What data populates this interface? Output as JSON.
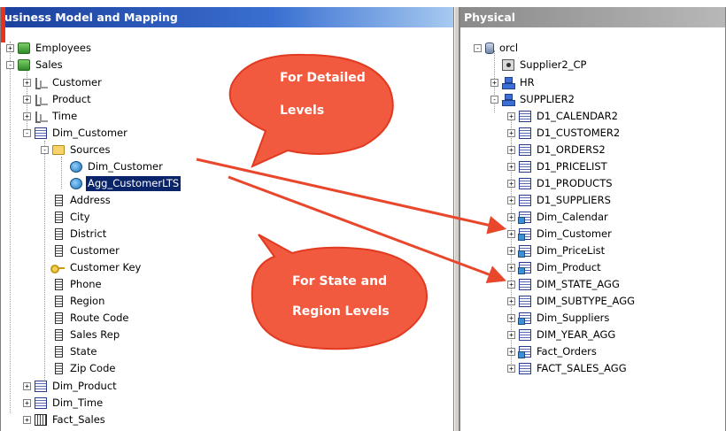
{
  "left_panel": {
    "title": "usiness Model and Mapping",
    "tree": [
      {
        "label": "Employees",
        "icon": "db-icon",
        "expander": "+"
      },
      {
        "label": "Sales",
        "icon": "db-icon",
        "expander": "-"
      },
      {
        "label": "Customer",
        "icon": "hierarchy-icon",
        "expander": "+"
      },
      {
        "label": "Product",
        "icon": "hierarchy-icon",
        "expander": "+"
      },
      {
        "label": "Time",
        "icon": "hierarchy-icon",
        "expander": "+"
      },
      {
        "label": "Dim_Customer",
        "icon": "table-icon",
        "expander": "-"
      },
      {
        "label": "Sources",
        "icon": "folder-icon",
        "expander": "-"
      },
      {
        "label": "Dim_Customer",
        "icon": "logical-table-source-icon"
      },
      {
        "label": "Agg_CustomerLTS",
        "icon": "logical-table-source-icon",
        "selected": true
      },
      {
        "label": "Address",
        "icon": "column-icon"
      },
      {
        "label": "City",
        "icon": "column-icon"
      },
      {
        "label": "District",
        "icon": "column-icon"
      },
      {
        "label": "Customer",
        "icon": "column-icon"
      },
      {
        "label": "Customer Key",
        "icon": "key-icon"
      },
      {
        "label": "Phone",
        "icon": "column-icon"
      },
      {
        "label": "Region",
        "icon": "column-icon"
      },
      {
        "label": "Route Code",
        "icon": "column-icon"
      },
      {
        "label": "Sales Rep",
        "icon": "column-icon"
      },
      {
        "label": "State",
        "icon": "column-icon"
      },
      {
        "label": "Zip Code",
        "icon": "column-icon"
      },
      {
        "label": "Dim_Product",
        "icon": "table-icon",
        "expander": "+"
      },
      {
        "label": "Dim_Time",
        "icon": "table-icon",
        "expander": "+"
      },
      {
        "label": "Fact_Sales",
        "icon": "fact-table-icon",
        "expander": "+"
      }
    ]
  },
  "right_panel": {
    "title": "Physical",
    "tree": [
      {
        "label": "orcl",
        "icon": "database-icon",
        "expander": "-"
      },
      {
        "label": "Supplier2_CP",
        "icon": "connection-pool-icon"
      },
      {
        "label": "HR",
        "icon": "schema-icon",
        "expander": "+"
      },
      {
        "label": "SUPPLIER2",
        "icon": "schema-icon",
        "expander": "-"
      },
      {
        "label": "D1_CALENDAR2",
        "icon": "table-icon",
        "expander": "+"
      },
      {
        "label": "D1_CUSTOMER2",
        "icon": "table-icon",
        "expander": "+"
      },
      {
        "label": "D1_ORDERS2",
        "icon": "table-icon",
        "expander": "+"
      },
      {
        "label": "D1_PRICELIST",
        "icon": "table-icon",
        "expander": "+"
      },
      {
        "label": "D1_PRODUCTS",
        "icon": "table-icon",
        "expander": "+"
      },
      {
        "label": "D1_SUPPLIERS",
        "icon": "table-icon",
        "expander": "+"
      },
      {
        "label": "Dim_Calendar",
        "icon": "alias-table-icon",
        "expander": "+"
      },
      {
        "label": "Dim_Customer",
        "icon": "alias-table-icon",
        "expander": "+"
      },
      {
        "label": "Dim_PriceList",
        "icon": "alias-table-icon",
        "expander": "+"
      },
      {
        "label": "Dim_Product",
        "icon": "alias-table-icon",
        "expander": "+"
      },
      {
        "label": "DIM_STATE_AGG",
        "icon": "table-icon",
        "expander": "+"
      },
      {
        "label": "DIM_SUBTYPE_AGG",
        "icon": "table-icon",
        "expander": "+"
      },
      {
        "label": "Dim_Suppliers",
        "icon": "alias-table-icon",
        "expander": "+"
      },
      {
        "label": "DIM_YEAR_AGG",
        "icon": "table-icon",
        "expander": "+"
      },
      {
        "label": "Fact_Orders",
        "icon": "alias-table-icon",
        "expander": "+"
      },
      {
        "label": "FACT_SALES_AGG",
        "icon": "table-icon",
        "expander": "+"
      }
    ]
  },
  "callouts": {
    "detailed": {
      "line1": "For Detailed",
      "line2": "Levels"
    },
    "state_region": {
      "line1": "For State and",
      "line2": "Region Levels"
    }
  },
  "colors": {
    "callout_fill": "#f15a3f",
    "callout_stroke": "#e23a20",
    "arrow": "#e8472c",
    "selection": "#0a246a"
  }
}
